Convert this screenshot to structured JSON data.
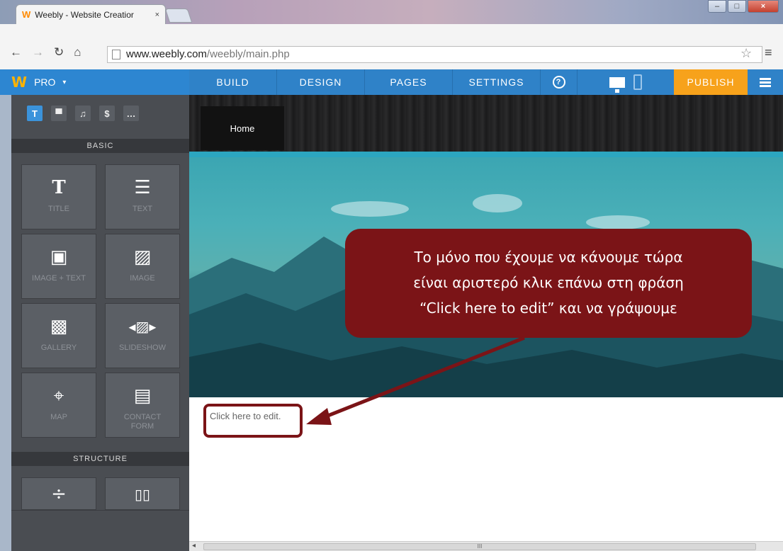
{
  "browser": {
    "tab_title": "Weebly - Website Creatior",
    "tab_close": "×",
    "url_host": "www.weebly.com",
    "url_path": "/weebly/main.php"
  },
  "topbar": {
    "plan": "PRO",
    "nav": [
      "BUILD",
      "DESIGN",
      "PAGES",
      "SETTINGS"
    ],
    "help": "?",
    "publish": "PUBLISH"
  },
  "sidebar": {
    "categories": [
      {
        "glyph": "T",
        "icon": "text-icon"
      },
      {
        "glyph": "▀",
        "icon": "layout-icon"
      },
      {
        "glyph": "♫",
        "icon": "music-icon"
      },
      {
        "glyph": "$",
        "icon": "dollar-icon"
      },
      {
        "glyph": "…",
        "icon": "more-icon"
      }
    ],
    "basic_label": "BASIC",
    "structure_label": "STRUCTURE",
    "basic_items": [
      {
        "label": "TITLE",
        "glyph": "T",
        "icon": "title-icon"
      },
      {
        "label": "TEXT",
        "glyph": "☰",
        "icon": "text-lines-icon"
      },
      {
        "label": "IMAGE + TEXT",
        "glyph": "▣",
        "icon": "image-text-icon"
      },
      {
        "label": "IMAGE",
        "glyph": "▨",
        "icon": "image-icon"
      },
      {
        "label": "GALLERY",
        "glyph": "▩",
        "icon": "gallery-icon"
      },
      {
        "label": "SLIDESHOW",
        "glyph": "◂▨▸",
        "icon": "slideshow-icon"
      },
      {
        "label": "MAP",
        "glyph": "⌖",
        "icon": "map-pin-icon"
      },
      {
        "label": "CONTACT FORM",
        "glyph": "▤",
        "icon": "contact-form-icon"
      }
    ],
    "structure_items": [
      {
        "glyph": "÷",
        "icon": "divider-icon"
      },
      {
        "glyph": "▯▯",
        "icon": "columns-icon"
      }
    ]
  },
  "canvas": {
    "home_tab": "Home",
    "edit_placeholder": "Click here to edit."
  },
  "callout": {
    "line1": "Το μόνο που έχουμε να κάνουμε τώρα",
    "line2": "είναι αριστερό κλικ επάνω στη φράση",
    "line3": "“Click here to edit” και να γράψουμε"
  },
  "colors": {
    "accent": "#2f82c8",
    "publish": "#f7a21b",
    "callout": "#7b1417"
  }
}
